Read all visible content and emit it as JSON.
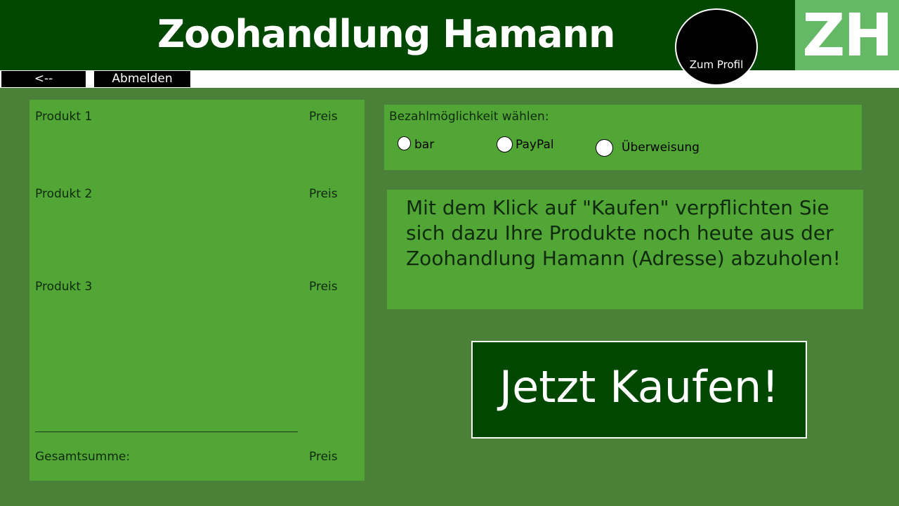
{
  "header": {
    "title": "Zoohandlung Hamann",
    "profile_label": "Zum Profil",
    "logo_text": "ZH"
  },
  "nav": {
    "back_label": "<--",
    "logout_label": "Abmelden"
  },
  "cart": {
    "items": [
      {
        "name": "Produkt 1",
        "price": "Preis"
      },
      {
        "name": "Produkt 2",
        "price": "Preis"
      },
      {
        "name": "Produkt 3",
        "price": "Preis"
      }
    ],
    "total_label": "Gesamtsumme:",
    "total_price": "Preis"
  },
  "payment": {
    "title": "Bezahlmöglichkeit wählen:",
    "options": [
      {
        "label": "bar"
      },
      {
        "label": "PayPal"
      },
      {
        "label": "Überweisung"
      }
    ]
  },
  "notice": {
    "text": "Mit dem Klick auf \"Kaufen\" verpflichten Sie sich dazu Ihre Produkte noch heute aus der Zoohandlung Hamann (Adresse) abzuholen!"
  },
  "buy": {
    "label": "Jetzt Kaufen!"
  },
  "colors": {
    "header_bg": "#004700",
    "page_bg": "#4a8038",
    "panel_bg": "#51a635",
    "logo_bg": "#65b866"
  }
}
